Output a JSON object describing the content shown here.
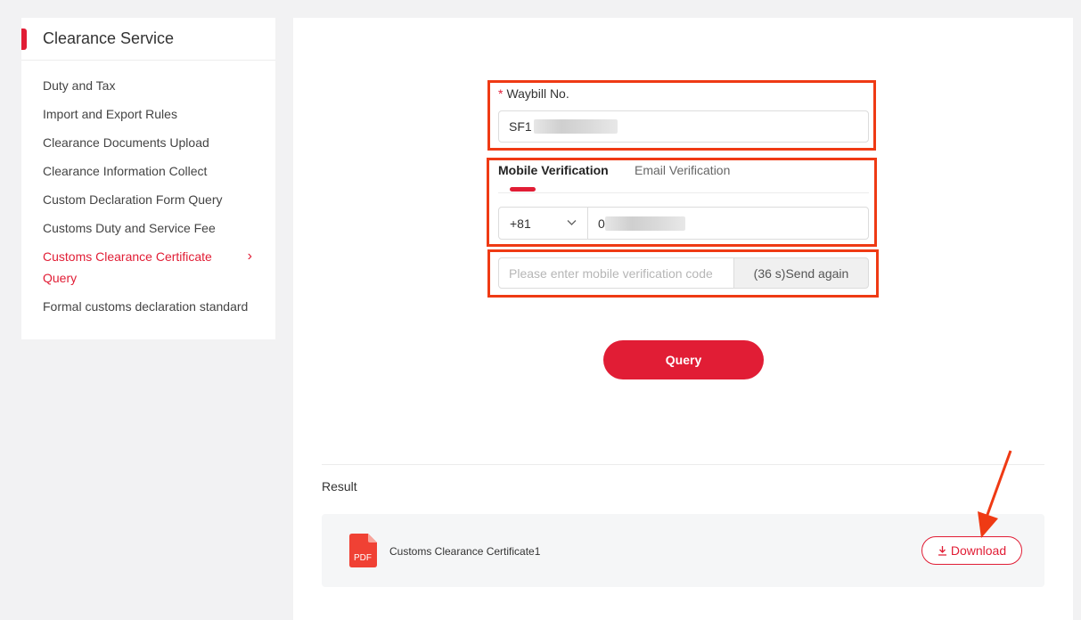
{
  "sidebar": {
    "title": "Clearance Service",
    "items": [
      {
        "label": "Duty and Tax"
      },
      {
        "label": "Import and Export Rules"
      },
      {
        "label": "Clearance Documents Upload"
      },
      {
        "label": "Clearance Information Collect"
      },
      {
        "label": "Custom Declaration Form Query"
      },
      {
        "label": "Customs Duty and Service Fee"
      },
      {
        "label": "Customs Clearance Certificate Query",
        "active": true
      },
      {
        "label": "Formal customs declaration standard"
      }
    ]
  },
  "form": {
    "waybill_label": "Waybill No.",
    "waybill_required_mark": "*",
    "waybill_value": "SF1",
    "tabs": [
      {
        "label": "Mobile Verification",
        "active": true
      },
      {
        "label": "Email Verification",
        "active": false
      }
    ],
    "country_code": "+81",
    "phone_value": "0",
    "code_placeholder": "Please enter mobile verification code",
    "send_again_label": "(36 s)Send again",
    "query_label": "Query"
  },
  "result": {
    "label": "Result",
    "file_badge": "PDF",
    "file_name": "Customs Clearance Certificate1",
    "download_label": "Download",
    "download_icon": "download-icon"
  },
  "colors": {
    "accent": "#e11d35",
    "annotation": "#ef3a14"
  }
}
